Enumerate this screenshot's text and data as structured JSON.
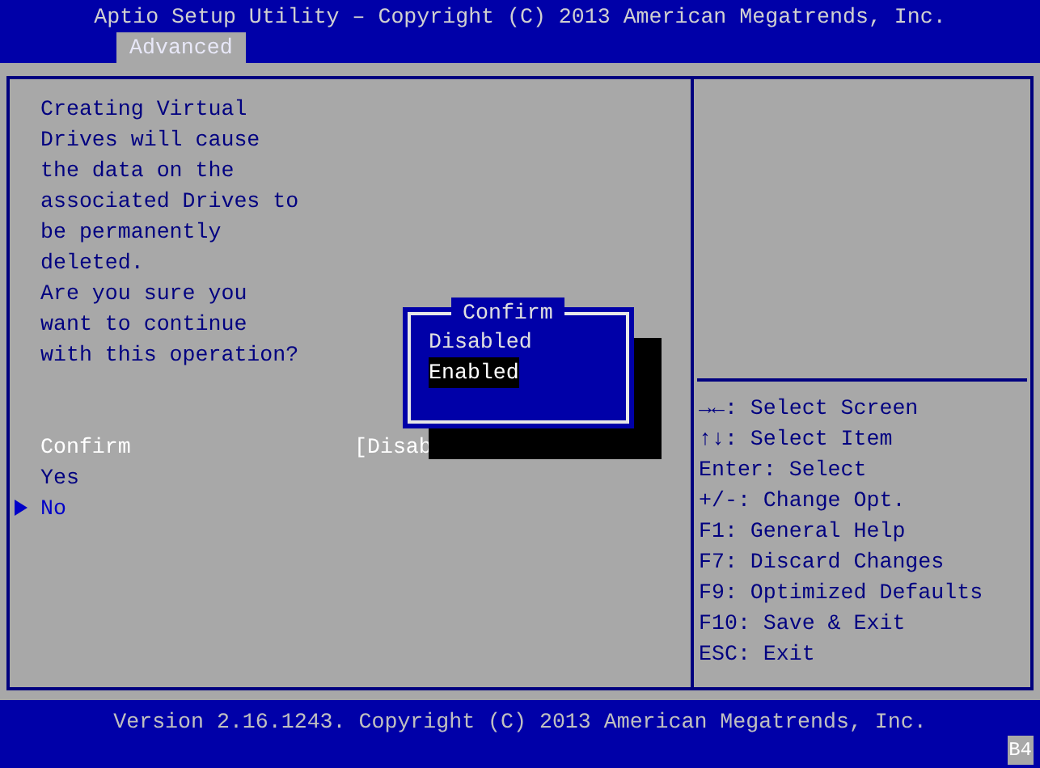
{
  "header": {
    "title": "Aptio Setup Utility – Copyright (C) 2013 American Megatrends, Inc.",
    "tabs": [
      {
        "label": "Advanced",
        "selected": true
      }
    ]
  },
  "description": [
    "Creating Virtual Drives will cause the data on the associated Drives to be permanently deleted.",
    "Are you sure you want to continue with this operation?"
  ],
  "items": [
    {
      "kind": "option",
      "label": "Confirm",
      "value": "[Disab",
      "selected": true
    },
    {
      "kind": "text",
      "label": "Yes",
      "selected": false
    },
    {
      "kind": "link",
      "label": "No",
      "selected": false
    }
  ],
  "popup": {
    "title": "Confirm",
    "options": [
      {
        "label": "Disabled",
        "selected": false
      },
      {
        "label": "Enabled",
        "selected": true
      }
    ]
  },
  "help": [
    "→←: Select Screen",
    "↑↓: Select Item",
    "Enter: Select",
    "+/-: Change Opt.",
    "F1: General Help",
    "F7: Discard Changes",
    "F9: Optimized Defaults",
    "F10: Save & Exit",
    "ESC: Exit"
  ],
  "footer": {
    "version": "Version 2.16.1243. Copyright (C) 2013 American Megatrends, Inc.",
    "badge": "B4"
  }
}
